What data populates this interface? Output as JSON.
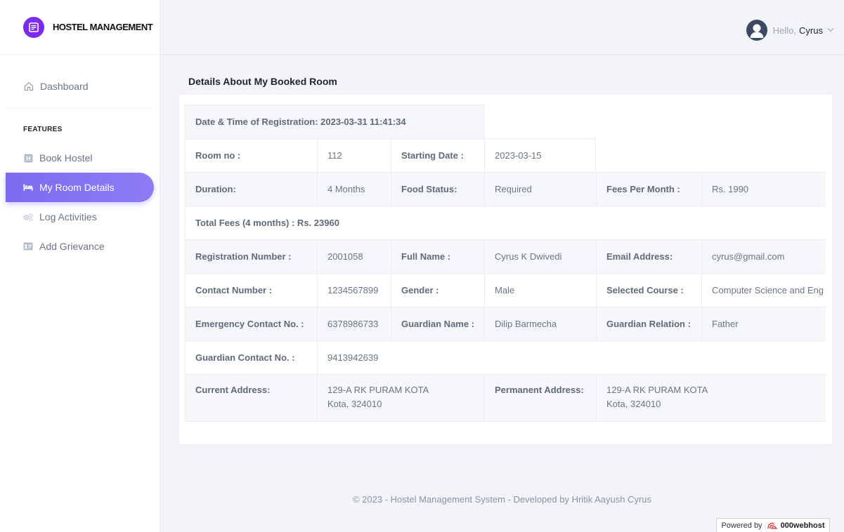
{
  "brand": {
    "name": "HOSTEL MANAGEMENT"
  },
  "user": {
    "greeting": "Hello,",
    "name": "Cyrus"
  },
  "sidebar": {
    "dashboard": "Dashboard",
    "section": "FEATURES",
    "items": [
      {
        "label": "Book Hostel",
        "icon": "hostel-icon"
      },
      {
        "label": "My Room Details",
        "icon": "bed-icon"
      },
      {
        "label": "Log Activities",
        "icon": "gears-icon"
      },
      {
        "label": "Add Grievance",
        "icon": "grievance-icon"
      }
    ]
  },
  "page": {
    "title": "Details About My Booked Room"
  },
  "details": {
    "registration_datetime": "Date & Time of Registration: 2023-03-31 11:41:34",
    "room_no_label": "Room no :",
    "room_no": "112",
    "starting_date_label": "Starting Date :",
    "starting_date": "2023-03-15",
    "duration_label": "Duration:",
    "duration": "4 Months",
    "food_status_label": "Food Status:",
    "food_status": "Required",
    "fees_per_month_label": "Fees Per Month :",
    "fees_per_month": "Rs. 1990",
    "total_fees": "Total Fees (4 months) : Rs. 23960",
    "registration_number_label": "Registration Number :",
    "registration_number": "2001058",
    "full_name_label": "Full Name :",
    "full_name": "Cyrus K Dwivedi",
    "email_label": "Email Address:",
    "email": "cyrus@gmail.com",
    "contact_label": "Contact Number :",
    "contact": "1234567899",
    "gender_label": "Gender :",
    "gender": "Male",
    "course_label": "Selected Course :",
    "course": "Computer Science and Eng",
    "emergency_label": "Emergency Contact No. :",
    "emergency": "6378986733",
    "guardian_name_label": "Guardian Name :",
    "guardian_name": "Dilip Barmecha",
    "guardian_relation_label": "Guardian Relation :",
    "guardian_relation": "Father",
    "guardian_contact_label": "Guardian Contact No. :",
    "guardian_contact": "9413942639",
    "current_address_label": "Current Address:",
    "current_address_line1": "129-A RK PURAM KOTA",
    "current_address_line2": "Kota, 324010",
    "permanent_address_label": "Permanent Address:",
    "permanent_address_line1": "129-A RK PURAM KOTA",
    "permanent_address_line2": "Kota, 324010"
  },
  "footer": {
    "text": "© 2023 - Hostel Management System - Developed by Hritik Aayush Cyrus"
  },
  "badge": {
    "prefix": "Powered by",
    "host": "000webhost"
  },
  "colors": {
    "accent": "#7b6cf0",
    "brand": "#7b2cf0"
  }
}
